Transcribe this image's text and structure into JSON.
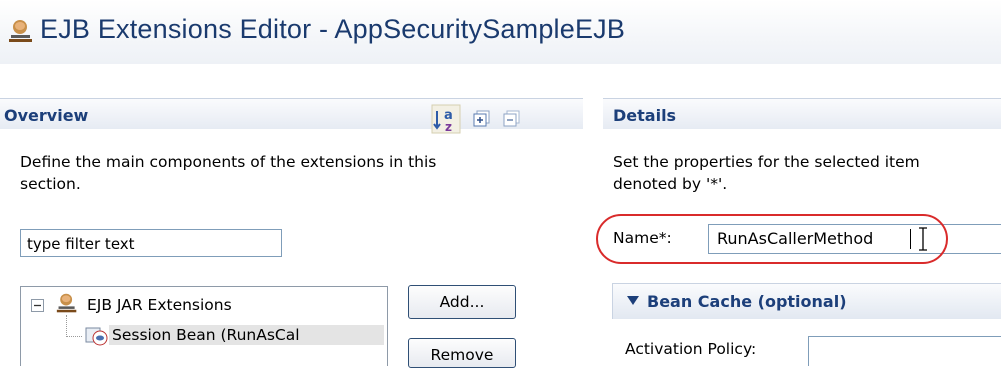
{
  "editor": {
    "title": "EJB Extensions Editor - AppSecuritySampleEJB"
  },
  "overview": {
    "title": "Overview",
    "description_line1": "Define the main components of the extensions in this",
    "description_line2": "section.",
    "filter_placeholder": "type filter text",
    "tree": [
      {
        "label": "EJB JAR Extensions",
        "expanded": true,
        "icon": "ejb-jar-icon"
      },
      {
        "label": "Session Bean (RunAsCal",
        "icon": "session-bean-icon",
        "selected": true
      }
    ],
    "buttons": {
      "add": "Add...",
      "remove": "Remove"
    }
  },
  "details": {
    "title": "Details",
    "description_line1": "Set the properties for the selected item",
    "description_line2": "denoted by '*'.",
    "name_label": "Name*:",
    "name_value": "RunAsCallerMethod",
    "bean_cache": {
      "title": "Bean Cache (optional)",
      "activation_label": "Activation Policy:",
      "activation_value": ""
    }
  },
  "colors": {
    "section_title": "#1c3f7a",
    "highlight": "#d92b2b"
  }
}
